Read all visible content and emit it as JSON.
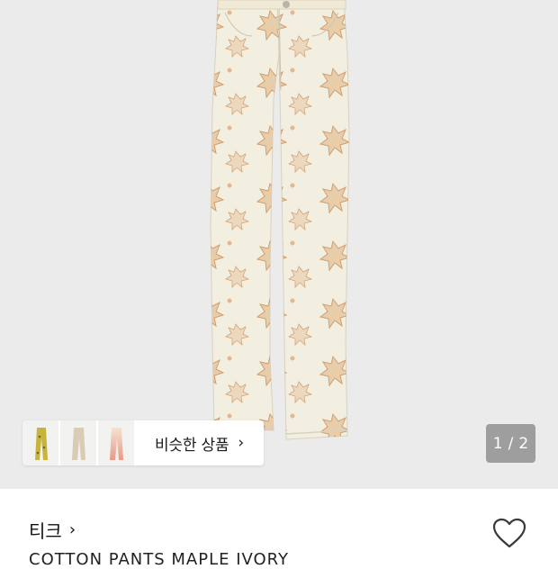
{
  "gallery": {
    "image": "leaf-print-pants-photo",
    "counter_current": "1",
    "counter_separator": "/",
    "counter_total": "2"
  },
  "similar": {
    "label": "비슷한 상품",
    "chevron": "›",
    "thumbnails": [
      "yellow-print-pants",
      "beige-pants",
      "pink-gradient-pants"
    ]
  },
  "product": {
    "brand": "티크",
    "brand_chevron": "›",
    "name": "COTTON PANTS MAPLE IVORY",
    "wishlist_icon": "heart-outline-icon"
  },
  "colors": {
    "hero_bg": "#ebebeb",
    "counter_bg": "#9e9e9e",
    "pants_base": "#f3efe0",
    "leaf_print": "#c98f5e"
  }
}
